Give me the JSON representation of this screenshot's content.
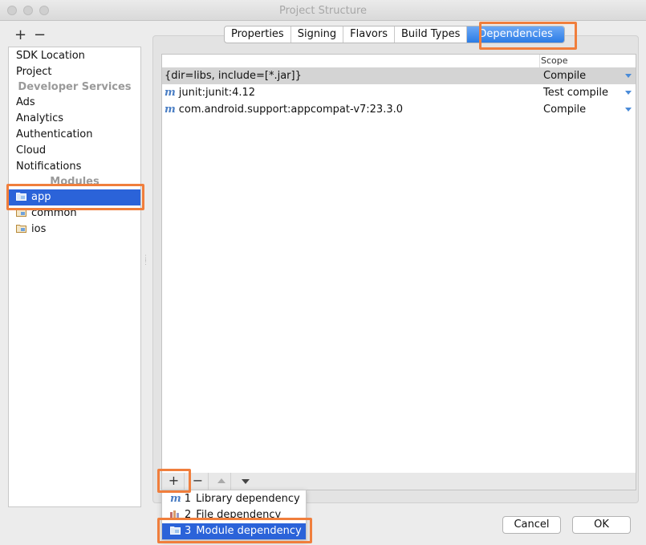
{
  "window": {
    "title": "Project Structure"
  },
  "left_toolbar": {
    "add": "+",
    "remove": "−"
  },
  "sidebar": {
    "top_items": [
      {
        "label": "SDK Location"
      },
      {
        "label": "Project"
      }
    ],
    "section_dev": "Developer Services",
    "dev_items": [
      {
        "label": "Ads"
      },
      {
        "label": "Analytics"
      },
      {
        "label": "Authentication"
      },
      {
        "label": "Cloud"
      },
      {
        "label": "Notifications"
      }
    ],
    "section_modules": "Modules",
    "modules": [
      {
        "label": "app",
        "selected": true
      },
      {
        "label": "common"
      },
      {
        "label": "ios"
      }
    ]
  },
  "tabs": [
    {
      "label": "Properties"
    },
    {
      "label": "Signing"
    },
    {
      "label": "Flavors"
    },
    {
      "label": "Build Types"
    },
    {
      "label": "Dependencies",
      "active": true
    }
  ],
  "table": {
    "scope_header": "Scope",
    "rows": [
      {
        "dependency": "{dir=libs, include=[*.jar]}",
        "scope": "Compile",
        "icon": "none",
        "selected": true
      },
      {
        "dependency": "junit:junit:4.12",
        "scope": "Test compile",
        "icon": "maven-icon"
      },
      {
        "dependency": "com.android.support:appcompat-v7:23.3.0",
        "scope": "Compile",
        "icon": "maven-icon"
      }
    ],
    "maven_glyph": "m"
  },
  "table_toolbar": {
    "add": "+",
    "remove": "−"
  },
  "popup": {
    "items": [
      {
        "num": "1",
        "label": "Library dependency",
        "icon": "maven-icon"
      },
      {
        "num": "2",
        "label": "File dependency",
        "icon": "file-icon"
      },
      {
        "num": "3",
        "label": "Module dependency",
        "icon": "module-folder-icon",
        "selected": true
      }
    ]
  },
  "buttons": {
    "cancel": "Cancel",
    "ok": "OK"
  },
  "colors": {
    "selection": "#2b63d9",
    "highlight": "#f07e3c",
    "tab_active": "#2b7ce6"
  }
}
